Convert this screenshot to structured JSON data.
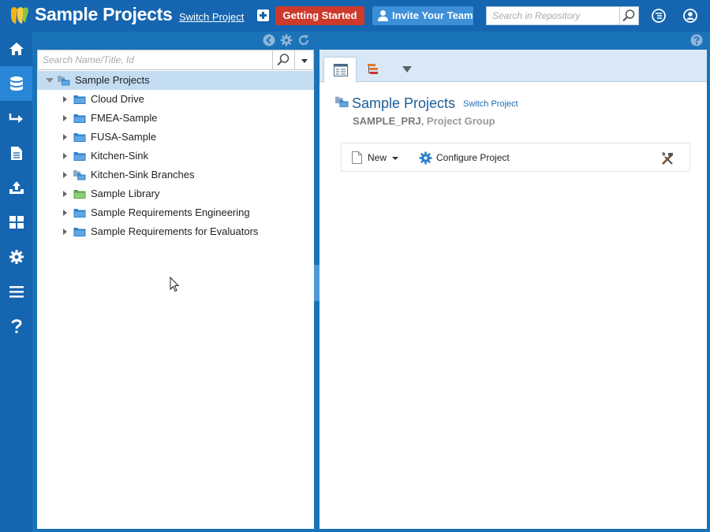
{
  "header": {
    "app_title": "Sample Projects",
    "switch_project_label": "Switch Project",
    "getting_started_label": "Getting Started",
    "invite_label": "Invite Your Team",
    "search_placeholder": "Search in Repository",
    "colors": {
      "bar": "#1565b0",
      "getting_started": "#cd3a2b",
      "invite": "#3d8fd8"
    }
  },
  "left_nav": {
    "items": [
      {
        "icon": "home-icon"
      },
      {
        "icon": "database-icon",
        "active": true
      },
      {
        "icon": "arrow-right-icon"
      },
      {
        "icon": "document-icon"
      },
      {
        "icon": "upload-icon"
      },
      {
        "icon": "grid-icon"
      },
      {
        "icon": "gear-icon"
      },
      {
        "icon": "menu-icon"
      },
      {
        "icon": "help-icon"
      }
    ]
  },
  "tree": {
    "search_placeholder": "Search Name/Title, Id",
    "root": {
      "label": "Sample Projects",
      "expanded": true,
      "selected": true
    },
    "items": [
      {
        "label": "Cloud Drive",
        "icon": "folder-blue-icon"
      },
      {
        "label": "FMEA-Sample",
        "icon": "folder-blue-icon"
      },
      {
        "label": "FUSA-Sample",
        "icon": "folder-blue-icon"
      },
      {
        "label": "Kitchen-Sink",
        "icon": "folder-blue-icon"
      },
      {
        "label": "Kitchen-Sink Branches",
        "icon": "folder-group-icon"
      },
      {
        "label": "Sample Library",
        "icon": "folder-green-icon"
      },
      {
        "label": "Sample Requirements Engineering",
        "icon": "folder-blue-icon"
      },
      {
        "label": "Sample Requirements for Evaluators",
        "icon": "folder-blue-icon"
      }
    ]
  },
  "detail": {
    "title": "Sample Projects",
    "switch_label": "Switch Project",
    "project_id": "SAMPLE_PRJ",
    "project_type": ", Project Group",
    "toolbar": {
      "new_label": "New",
      "configure_label": "Configure Project"
    }
  }
}
